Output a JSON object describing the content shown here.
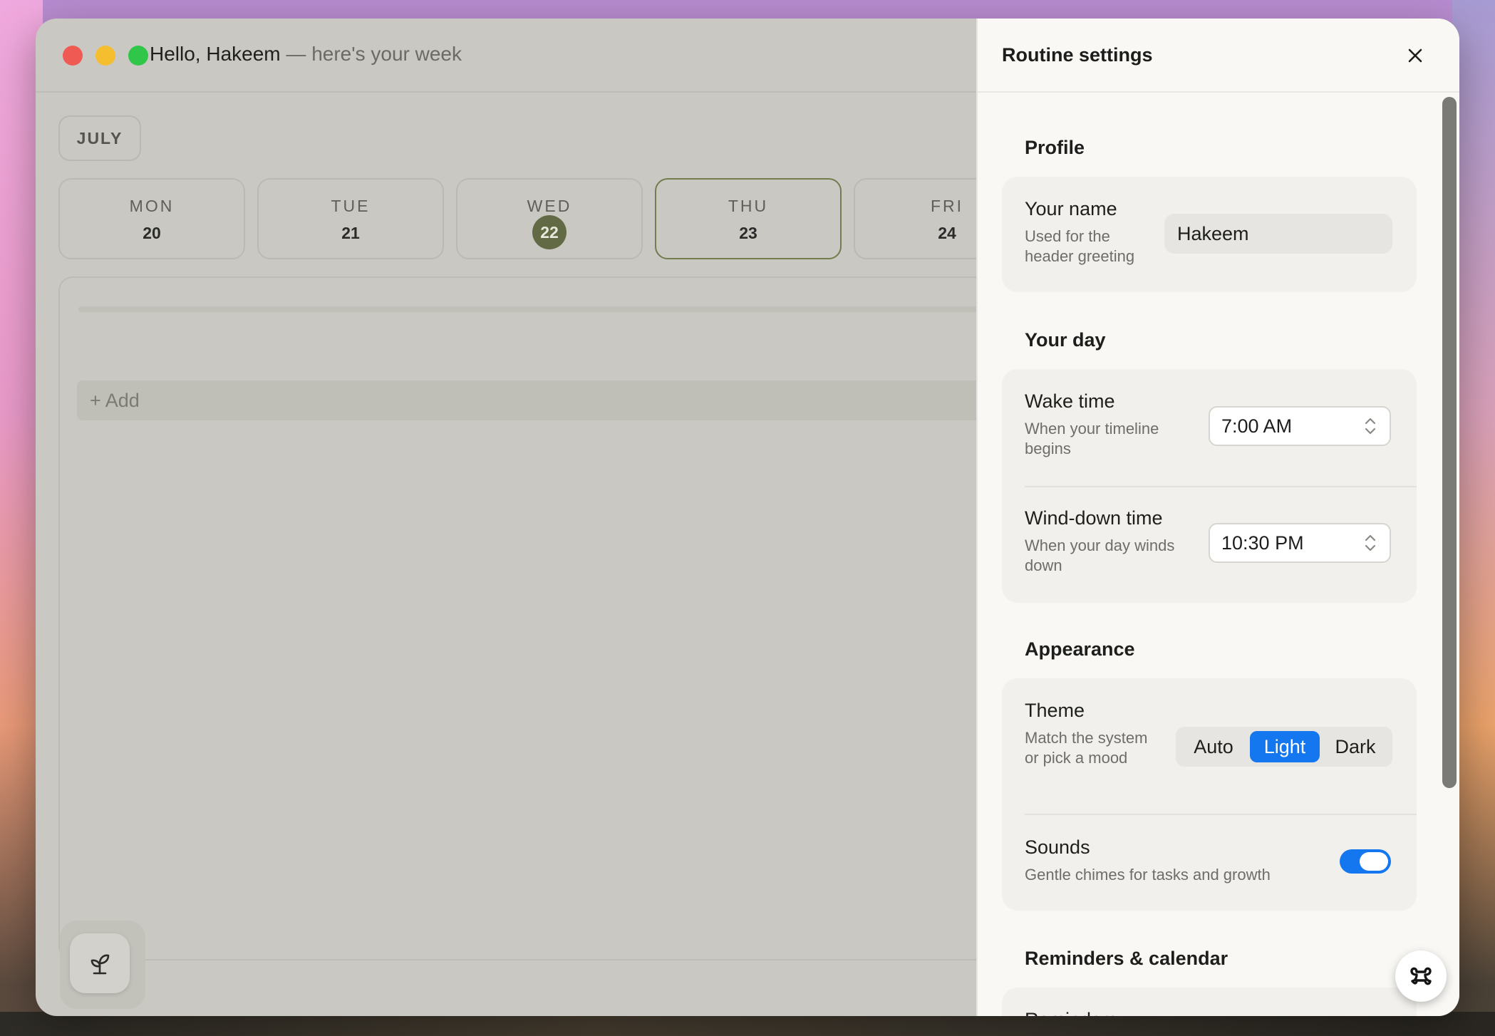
{
  "header": {
    "greeting": "Hello, Hakeem",
    "subtitle": " — here's your week"
  },
  "calendar": {
    "month": "JULY",
    "days": [
      {
        "name": "MON",
        "number": "20"
      },
      {
        "name": "TUE",
        "number": "21"
      },
      {
        "name": "WED",
        "number": "22"
      },
      {
        "name": "THU",
        "number": "23"
      },
      {
        "name": "FRI",
        "number": "24"
      }
    ],
    "today_index": 2,
    "selected_index": 3
  },
  "timeline": {
    "add_label": "+ Add"
  },
  "settings": {
    "title": "Routine settings",
    "profile": {
      "section_title": "Profile",
      "name_label": "Your name",
      "name_desc": "Used for the header greeting",
      "name_value": "Hakeem"
    },
    "day": {
      "section_title": "Your day",
      "wake_label": "Wake time",
      "wake_desc": "When your timeline begins",
      "wake_value": "7:00 AM",
      "winddown_label": "Wind-down time",
      "winddown_desc": "When your day winds down",
      "winddown_value": "10:30 PM"
    },
    "appearance": {
      "section_title": "Appearance",
      "theme_label": "Theme",
      "theme_desc": "Match the system or pick a mood",
      "theme_options": [
        "Auto",
        "Light",
        "Dark"
      ],
      "theme_selected": "Light",
      "sounds_label": "Sounds",
      "sounds_desc": "Gentle chimes for tasks and growth",
      "sounds_on": true
    },
    "reminders": {
      "section_title": "Reminders & calendar",
      "reminders_label": "Reminders"
    }
  },
  "icons": {
    "close": "close-icon",
    "plant": "sprout-icon",
    "float": "clover-icon"
  },
  "colors": {
    "accent": "#1577f0",
    "today": "#616a45",
    "selected_border": "#727c4e"
  }
}
